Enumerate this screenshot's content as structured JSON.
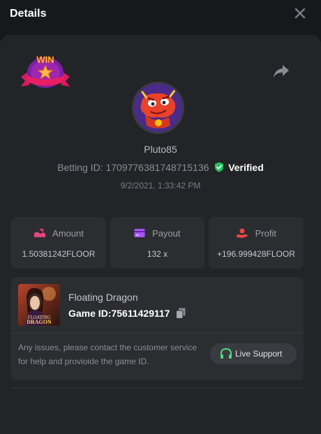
{
  "header": {
    "title": "Details"
  },
  "player": {
    "username": "Pluto85",
    "betting_id_label": "Betting ID:",
    "betting_id": "1709776381748715136",
    "verified": "Verified",
    "datetime": "9/2/2021, 1:33:42 PM",
    "badge_text": "WIN"
  },
  "stats": [
    {
      "label": "Amount",
      "value": "1.50381242FLOOR"
    },
    {
      "label": "Payout",
      "value": "132 x"
    },
    {
      "label": "Profit",
      "value": "+196.999428FLOOR"
    }
  ],
  "game": {
    "name": "Floating Dragon",
    "id_label": "Game ID:",
    "id": "75611429117",
    "thumb_text_1": "FLOATING",
    "thumb_text_2": "DRAGON"
  },
  "support": {
    "text": "Any issues, please contact the customer service for help and provioide the game ID.",
    "button_label": "Live Support"
  },
  "colors": {
    "background": "#17181b",
    "panel": "#232427",
    "card": "#2c2d31",
    "verified_green": "#22c55e",
    "amount_icon": "#e0467c",
    "payout_icon": "#a855f7",
    "profit_icon": "#ef4444",
    "support_icon": "#4ade80"
  }
}
